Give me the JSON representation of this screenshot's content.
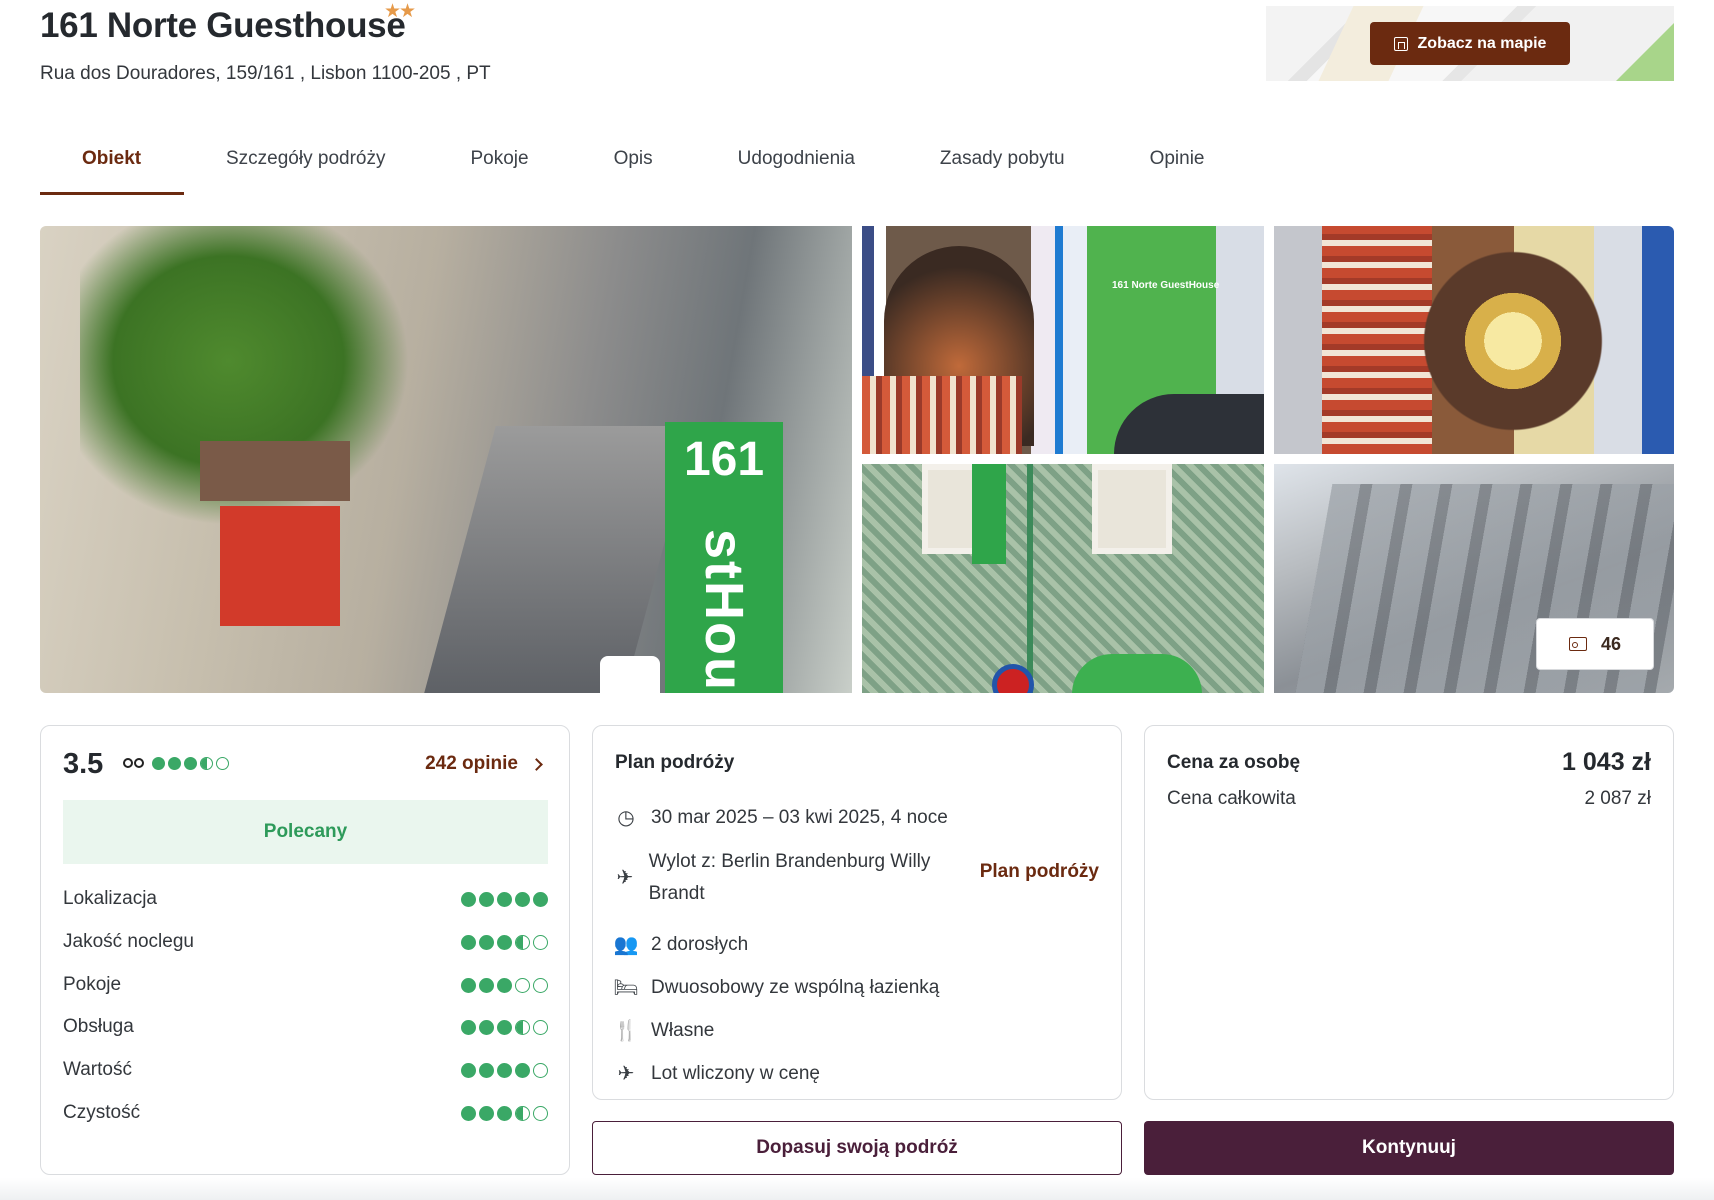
{
  "hotel": {
    "name": "161 Norte Guesthouse",
    "stars": "★★",
    "address": "Rua dos Douradores, 159/161 , Lisbon 1100-205 , PT",
    "map_button": "Zobacz na mapie"
  },
  "tabs": [
    {
      "label": "Obiekt",
      "active": true
    },
    {
      "label": "Szczegóły podróży"
    },
    {
      "label": "Pokoje"
    },
    {
      "label": "Opis"
    },
    {
      "label": "Udogodnienia"
    },
    {
      "label": "Zasady pobytu"
    },
    {
      "label": "Opinie"
    }
  ],
  "gallery": {
    "main_sign_text": "161",
    "main_sign_vertical": "stHouse",
    "photo2_label": "161 Norte GuestHouse",
    "photo_count": "46"
  },
  "rating": {
    "score": "3.5",
    "score_dots": 3.5,
    "reviews_link": "242 opinie",
    "badge": "Polecany",
    "criteria": [
      {
        "label": "Lokalizacja",
        "value": 5
      },
      {
        "label": "Jakość noclegu",
        "value": 3.5
      },
      {
        "label": "Pokoje",
        "value": 3
      },
      {
        "label": "Obsługa",
        "value": 3.5
      },
      {
        "label": "Wartość",
        "value": 4
      },
      {
        "label": "Czystość",
        "value": 3.5
      }
    ]
  },
  "plan": {
    "title": "Plan podróży",
    "link": "Plan podróży",
    "rows": [
      {
        "icon": "calendar-icon",
        "text": "30 mar 2025 – 03 kwi 2025, 4 noce"
      },
      {
        "icon": "plane-departure-icon",
        "text": "Wylot z: Berlin Brandenburg Willy Brandt"
      },
      {
        "icon": "people-icon",
        "text": "2 dorosłych"
      },
      {
        "icon": "bed-icon",
        "text": "Dwuosobowy ze wspólną łazienką"
      },
      {
        "icon": "cutlery-icon",
        "text": "Własne"
      },
      {
        "icon": "plane-icon",
        "text": "Lot wliczony w cenę"
      }
    ]
  },
  "price": {
    "per_person_label": "Cena za osobę",
    "per_person_value": "1 043 zł",
    "total_label": "Cena całkowita",
    "total_value": "2 087 zł"
  },
  "buttons": {
    "customize": "Dopasuj swoją podróż",
    "continue": "Kontynuuj"
  },
  "colors": {
    "brand": "#6b2a10",
    "primary_button": "#4a1f3a",
    "rating_green": "#3aa866",
    "star": "#e69a4a"
  }
}
